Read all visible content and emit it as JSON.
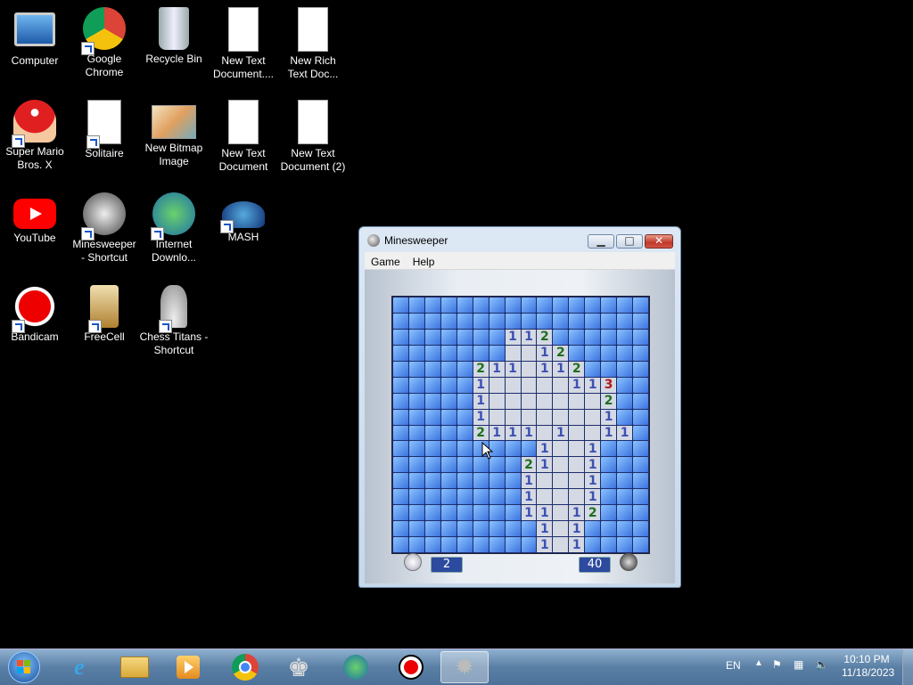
{
  "desktop": {
    "icons": [
      {
        "label": "Computer"
      },
      {
        "label": "Google\nChrome"
      },
      {
        "label": "Recycle Bin"
      },
      {
        "label": "New Text\nDocument...."
      },
      {
        "label": "New Rich\nText Doc..."
      },
      {
        "label": "Super Mario\nBros. X"
      },
      {
        "label": "Solitaire"
      },
      {
        "label": "New Bitmap\nImage"
      },
      {
        "label": "New Text\nDocument"
      },
      {
        "label": "New Text\nDocument (2)"
      },
      {
        "label": "YouTube"
      },
      {
        "label": "Minesweeper\n- Shortcut"
      },
      {
        "label": "Internet\nDownlo..."
      },
      {
        "label": "MASH"
      },
      {
        "label": "Bandicam"
      },
      {
        "label": "FreeCell"
      },
      {
        "label": "Chess Titans -\nShortcut"
      }
    ]
  },
  "window": {
    "title": "Minesweeper",
    "menu": [
      "Game",
      "Help"
    ],
    "min_label": "▁",
    "max_label": "□",
    "close_label": "✕",
    "timer": "2",
    "mines_left": "40"
  },
  "board": {
    "rows": [
      "################",
      "################",
      "#######112######",
      "#######. 12#####",
      "#####211 112####",
      "#####1     113##",
      "#####1       2##",
      "#####1       1##",
      "#####2111 1  11#",
      "#########1  1###",
      "########21  1###",
      "########1   1###",
      "########1   1###",
      "########11 12###",
      "#########1 1####",
      "#########1 1####"
    ]
  },
  "taskbar": {
    "items": [
      "start",
      "internet-explorer",
      "file-explorer",
      "media-player",
      "chrome",
      "chess",
      "idm",
      "bandicam",
      "minesweeper"
    ],
    "lang": "EN",
    "time": "10:10 PM",
    "date": "11/18/2023"
  }
}
